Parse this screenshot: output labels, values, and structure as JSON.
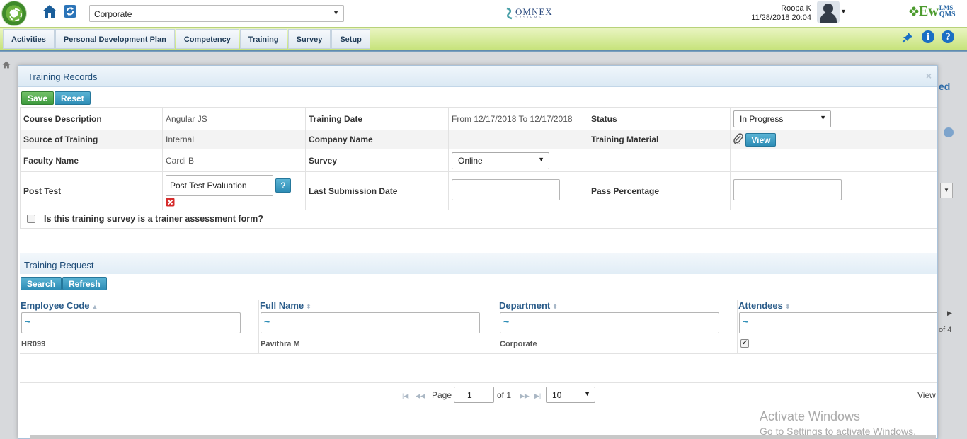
{
  "topbar": {
    "company_select": "Corporate",
    "brand_main": "OMNEX",
    "brand_sub": "SYSTEMS",
    "user_name": "Roopa K",
    "datetime": "11/28/2018 20:04",
    "product_logo_main": "Ew",
    "product_logo_lms": "LMS",
    "product_logo_qms": "QMS"
  },
  "nav": {
    "items": [
      {
        "label": "Activities"
      },
      {
        "label": "Personal Development Plan"
      },
      {
        "label": "Competency"
      },
      {
        "label": "Training"
      },
      {
        "label": "Survey"
      },
      {
        "label": "Setup"
      }
    ]
  },
  "background": {
    "right_text": "ed",
    "right_pager_text": "of 4"
  },
  "modal": {
    "title": "Training Records",
    "close_glyph": "×",
    "save_label": "Save",
    "reset_label": "Reset",
    "form": {
      "course_description_label": "Course Description",
      "course_description_value": "Angular JS",
      "training_date_label": "Training Date",
      "training_date_value": "From 12/17/2018 To 12/17/2018",
      "status_label": "Status",
      "status_value": "In Progress",
      "source_label": "Source of Training",
      "source_value": "Internal",
      "company_label": "Company Name",
      "company_value": "",
      "material_label": "Training Material",
      "view_label": "View",
      "faculty_label": "Faculty Name",
      "faculty_value": "Cardi B",
      "survey_label": "Survey",
      "survey_value": "Online",
      "post_test_label": "Post Test",
      "post_test_value": "Post Test Evaluation",
      "help_glyph": "?",
      "last_submission_label": "Last Submission Date",
      "last_submission_value": "",
      "pass_percentage_label": "Pass Percentage",
      "pass_percentage_value": "",
      "trainer_assessment_label": "Is this training survey is a trainer assessment form?"
    },
    "request": {
      "title": "Training Request",
      "search_label": "Search",
      "refresh_label": "Refresh",
      "columns": [
        {
          "label": "Employee Code"
        },
        {
          "label": "Full Name"
        },
        {
          "label": "Department"
        },
        {
          "label": "Attendees"
        }
      ],
      "filter_value": "~",
      "rows": [
        {
          "code": "HR099",
          "name": "Pavithra M",
          "department": "Corporate",
          "attendee": true
        }
      ],
      "pager": {
        "page_label": "Page",
        "page_value": "1",
        "of_label": "of 1",
        "page_size": "10",
        "view_label": "View"
      }
    }
  },
  "watermark": {
    "line1": "Activate Windows",
    "line2": "Go to Settings to activate Windows."
  },
  "colors": {
    "nav_green": "#c7e37c",
    "accent_blue": "#2e8db6",
    "save_green": "#3d9a3d"
  }
}
